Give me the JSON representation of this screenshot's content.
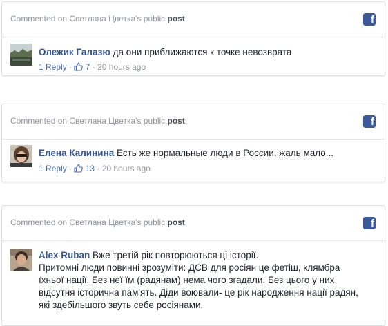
{
  "cards": [
    {
      "context_prefix": "Commented on Светлана Цветка's public",
      "context_link": "post",
      "fb_logo": "f",
      "author": "Олежик Галазю",
      "text": "да они приближаются к точке невозврата",
      "reply": "1 Reply",
      "likes": "7",
      "time": "20 hours ago"
    },
    {
      "context_prefix": "Commented on Светлана Цветка's public",
      "context_link": "post",
      "fb_logo": "f",
      "author": "Елена Калинина",
      "text": "Есть же нормальные люди в России, жаль мало...",
      "reply": "1 Reply",
      "likes": "13",
      "time": "20 hours ago"
    },
    {
      "context_prefix": "Commented on Светлана Цветка's public",
      "context_link": "post",
      "fb_logo": "f",
      "author": "Alex Ruban",
      "text_line1": "Вже третій рік повторюються ці історії.",
      "text_line2": "Притомні люди повинні зрозуміти: ДСВ для росіян це фетіш, клямбра",
      "text_line3": "їхньої нації. Без неї їм (радянам) нема чого згадали. Без цього у них",
      "text_line4": "відсутня історична пам'ять. Діди воювали- це рік народження нації радян,",
      "text_line5": "які здебільшого звуть себе росіянами."
    }
  ],
  "colors": {
    "facebook_blue": "#3b5998",
    "link_blue": "#365899",
    "meta_gray": "#90949c",
    "border": "#dddfe2"
  },
  "icons": {
    "brand": "facebook-icon",
    "like": "thumbs-up-icon"
  }
}
